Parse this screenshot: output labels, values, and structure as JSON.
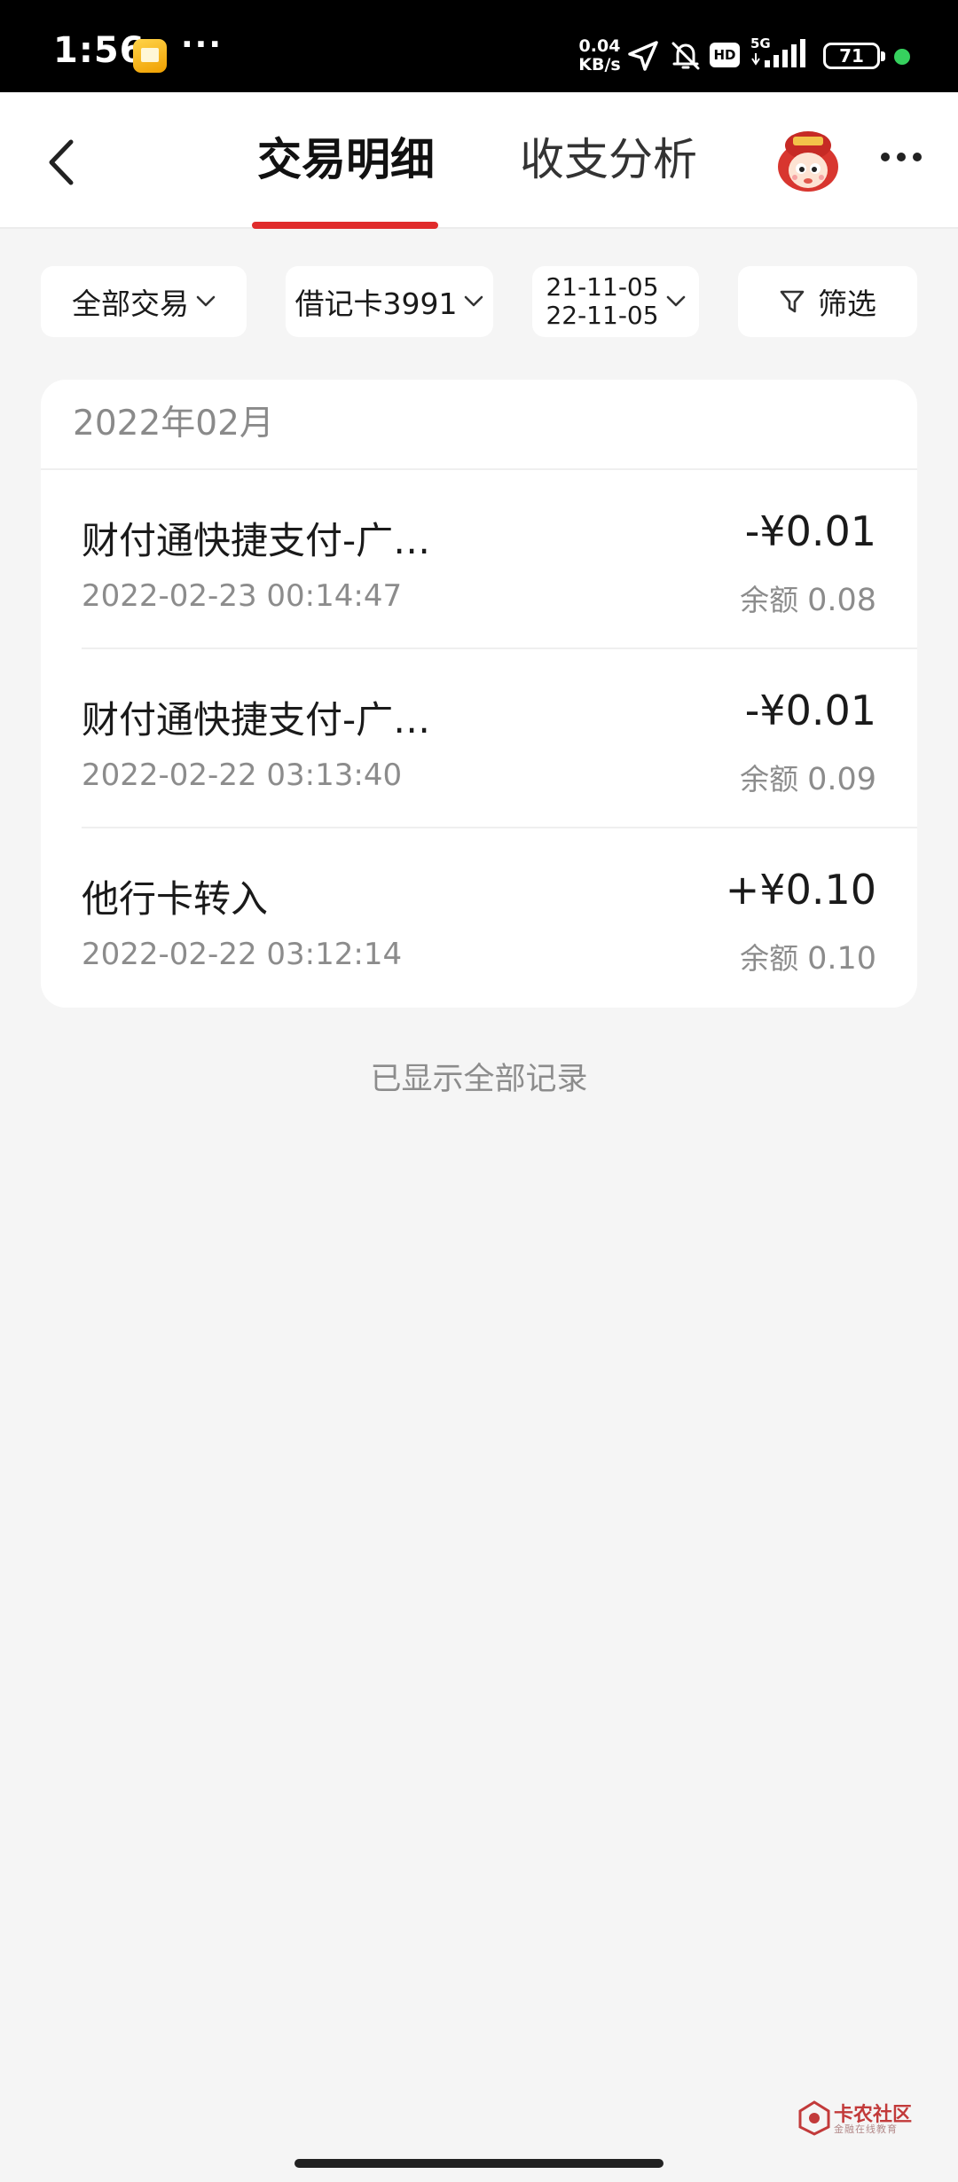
{
  "status_bar": {
    "time": "1:56",
    "more": "···",
    "net_speed_value": "0.04",
    "net_speed_unit": "KB/s",
    "hd": "HD",
    "network": "5G",
    "battery": "71"
  },
  "header": {
    "tabs": [
      {
        "label": "交易明细",
        "active": true
      },
      {
        "label": "收支分析",
        "active": false
      }
    ],
    "accent_color": "#e02b2b"
  },
  "filters": {
    "type_label": "全部交易",
    "card_label": "借记卡3991",
    "date_start": "21-11-05",
    "date_end": "22-11-05",
    "screen_label": "筛选"
  },
  "month": "2022年02月",
  "balance_label": "余额",
  "transactions": [
    {
      "title": "财付通快捷支付-广…",
      "time": "2022-02-23 00:14:47",
      "amount": "-¥0.01",
      "balance": "0.08"
    },
    {
      "title": "财付通快捷支付-广…",
      "time": "2022-02-22 03:13:40",
      "amount": "-¥0.01",
      "balance": "0.09"
    },
    {
      "title": "他行卡转入",
      "time": "2022-02-22 03:12:14",
      "amount": "+¥0.10",
      "balance": "0.10"
    }
  ],
  "end_note": "已显示全部记录",
  "watermark": {
    "name": "卡农社区",
    "sub": "金融在线教育"
  }
}
